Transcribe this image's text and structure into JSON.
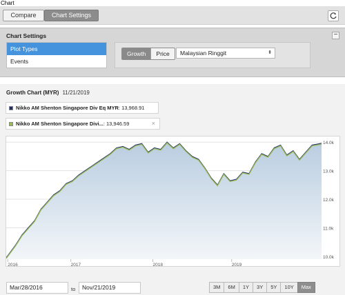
{
  "window": {
    "title": "Chart"
  },
  "tabs": {
    "compare": "Compare",
    "chart_settings": "Chart Settings"
  },
  "toolbar": {
    "refresh_icon": "refresh-icon"
  },
  "settings": {
    "title": "Chart Settings",
    "collapse_label": "−",
    "menu": [
      "Plot Types",
      "Events"
    ],
    "active_menu": "Plot Types",
    "mode": {
      "growth": "Growth",
      "price": "Price",
      "selected": "Growth"
    },
    "currency": "Malaysian Ringgit"
  },
  "chart": {
    "title": "Growth Chart (MYR)",
    "date": "11/21/2019",
    "legend": [
      {
        "name": "Nikko AM Shenton Singapore Div Eq MYR",
        "value": ": 13,968.91",
        "color": "#1f2d6a"
      },
      {
        "name": "Nikko AM Shenton Singapore Divi...",
        "value": ": 13,946.59",
        "color": "#9bbb59"
      }
    ],
    "legend_close": "×",
    "from_date": "Mar/28/2016",
    "to_label": "to",
    "to_date": "Nov/21/2019",
    "ranges": [
      "3M",
      "6M",
      "1Y",
      "3Y",
      "5Y",
      "10Y",
      "Max"
    ],
    "selected_range": "Max"
  },
  "chart_data": {
    "type": "area",
    "x_ticks": [
      "2016",
      "2017",
      "2018",
      "2019"
    ],
    "y_ticks": [
      "10.0k",
      "11.0k",
      "12.0k",
      "13.0k",
      "14.0k"
    ],
    "ylim": [
      9900,
      14150
    ],
    "grid": true,
    "x": [
      0,
      0.03,
      0.05,
      0.07,
      0.09,
      0.11,
      0.13,
      0.15,
      0.17,
      0.19,
      0.21,
      0.23,
      0.25,
      0.27,
      0.29,
      0.31,
      0.33,
      0.35,
      0.37,
      0.39,
      0.41,
      0.43,
      0.45,
      0.47,
      0.49,
      0.51,
      0.53,
      0.55,
      0.57,
      0.59,
      0.61,
      0.63,
      0.65,
      0.67,
      0.69,
      0.71,
      0.73,
      0.75,
      0.77,
      0.79,
      0.81,
      0.83,
      0.85,
      0.87,
      0.89,
      0.91,
      0.93,
      0.95,
      0.97,
      1.0
    ],
    "series": [
      {
        "values": [
          9950,
          10400,
          10750,
          11000,
          11250,
          11650,
          11900,
          12150,
          12300,
          12550,
          12650,
          12850,
          13000,
          13150,
          13300,
          13450,
          13600,
          13800,
          13850,
          13750,
          13900,
          13950,
          13650,
          13800,
          13750,
          14000,
          13800,
          13950,
          13700,
          13500,
          13400,
          13100,
          12750,
          12500,
          12900,
          12650,
          12700,
          12950,
          12900,
          13300,
          13600,
          13500,
          13800,
          13900,
          13550,
          13700,
          13400,
          13650,
          13900,
          13960
        ]
      },
      {
        "values": [
          9940,
          10390,
          10740,
          10990,
          11240,
          11640,
          11890,
          12140,
          12290,
          12540,
          12640,
          12840,
          12990,
          13140,
          13290,
          13440,
          13590,
          13790,
          13840,
          13740,
          13890,
          13940,
          13640,
          13790,
          13740,
          13990,
          13790,
          13940,
          13690,
          13490,
          13390,
          13090,
          12740,
          12490,
          12890,
          12640,
          12690,
          12940,
          12890,
          13290,
          13590,
          13490,
          13790,
          13890,
          13540,
          13690,
          13390,
          13640,
          13890,
          13945
        ]
      }
    ]
  }
}
